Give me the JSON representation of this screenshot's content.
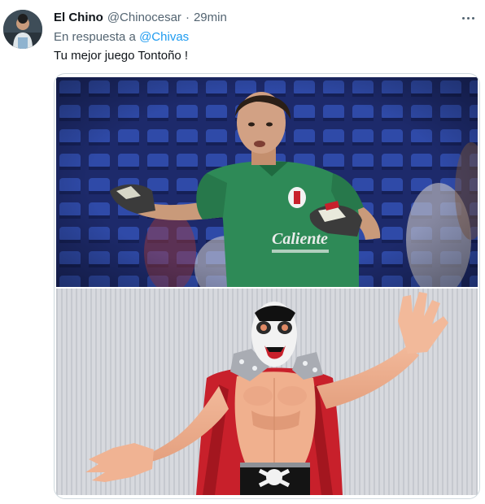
{
  "tweet": {
    "display_name": "El Chino",
    "handle": "@Chinocesar",
    "separator": "·",
    "time": "29min",
    "reply_prefix": "En respuesta a",
    "reply_mention": "@Chivas",
    "text": "Tu mejor juego Tontoño !",
    "jersey_sponsor": "Caliente"
  },
  "media": {
    "photos": [
      "goalkeeper-photo",
      "wrestler-figure-photo"
    ]
  },
  "colors": {
    "mention": "#1d9bf0",
    "secondary_text": "#536471",
    "primary_text": "#0f1419",
    "jersey_green": "#2e8a57",
    "cape_red": "#c8202b"
  }
}
